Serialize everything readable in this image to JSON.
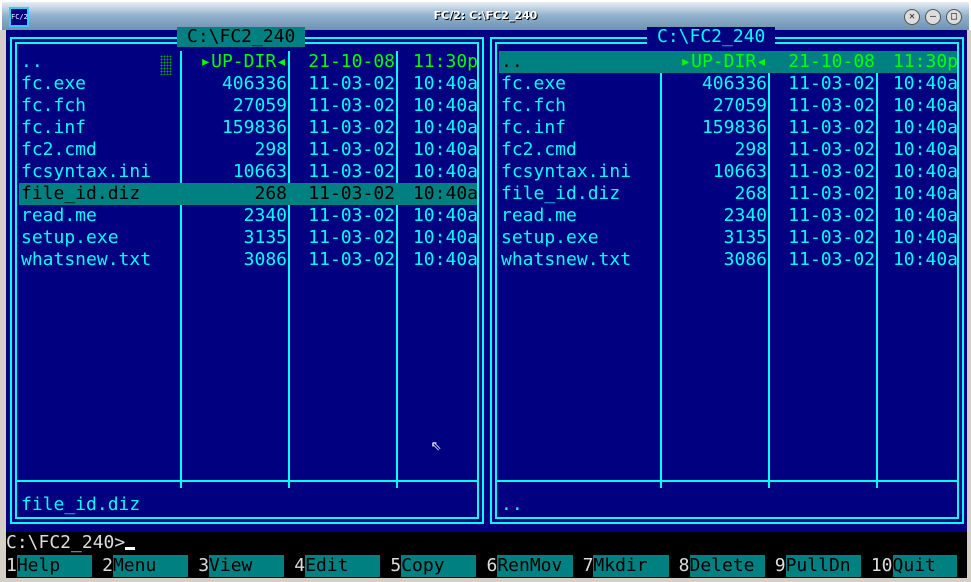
{
  "window": {
    "title": "FC/2: C:\\FC2_240",
    "icon": "FC/2"
  },
  "panels": [
    {
      "path": "C:\\FC2_240",
      "active": true,
      "info": "file_id.diz",
      "selected": 5,
      "files": [
        {
          "name": "..",
          "size": "▸UP-DIR◂",
          "date": "21-10-08",
          "time": "11:30p"
        },
        {
          "name": "fc.exe",
          "size": "406336",
          "date": "11-03-02",
          "time": "10:40a"
        },
        {
          "name": "fc.fch",
          "size": "27059",
          "date": "11-03-02",
          "time": "10:40a"
        },
        {
          "name": "fc.inf",
          "size": "159836",
          "date": "11-03-02",
          "time": "10:40a"
        },
        {
          "name": "fc2.cmd",
          "size": "298",
          "date": "11-03-02",
          "time": "10:40a"
        },
        {
          "name": "fcsyntax.ini",
          "size": "10663",
          "date": "11-03-02",
          "time": "10:40a"
        },
        {
          "name": "file_id.diz",
          "size": "268",
          "date": "11-03-02",
          "time": "10:40a"
        },
        {
          "name": "read.me",
          "size": "2340",
          "date": "11-03-02",
          "time": "10:40a"
        },
        {
          "name": "setup.exe",
          "size": "3135",
          "date": "11-03-02",
          "time": "10:40a"
        },
        {
          "name": "whatsnew.txt",
          "size": "3086",
          "date": "11-03-02",
          "time": "10:40a"
        }
      ]
    },
    {
      "path": "C:\\FC2_240",
      "active": false,
      "info": "..",
      "selected": -1,
      "files": [
        {
          "name": "..",
          "size": "▸UP-DIR◂",
          "date": "21-10-08",
          "time": "11:30p"
        },
        {
          "name": "fc.exe",
          "size": "406336",
          "date": "11-03-02",
          "time": "10:40a"
        },
        {
          "name": "fc.fch",
          "size": "27059",
          "date": "11-03-02",
          "time": "10:40a"
        },
        {
          "name": "fc.inf",
          "size": "159836",
          "date": "11-03-02",
          "time": "10:40a"
        },
        {
          "name": "fc2.cmd",
          "size": "298",
          "date": "11-03-02",
          "time": "10:40a"
        },
        {
          "name": "fcsyntax.ini",
          "size": "10663",
          "date": "11-03-02",
          "time": "10:40a"
        },
        {
          "name": "file_id.diz",
          "size": "268",
          "date": "11-03-02",
          "time": "10:40a"
        },
        {
          "name": "read.me",
          "size": "2340",
          "date": "11-03-02",
          "time": "10:40a"
        },
        {
          "name": "setup.exe",
          "size": "3135",
          "date": "11-03-02",
          "time": "10:40a"
        },
        {
          "name": "whatsnew.txt",
          "size": "3086",
          "date": "11-03-02",
          "time": "10:40a"
        }
      ]
    }
  ],
  "command_prompt": "C:\\FC2_240>",
  "keybar": [
    {
      "num": "1",
      "label": "Help"
    },
    {
      "num": "2",
      "label": "Menu"
    },
    {
      "num": "3",
      "label": "View"
    },
    {
      "num": "4",
      "label": "Edit"
    },
    {
      "num": "5",
      "label": "Copy"
    },
    {
      "num": "6",
      "label": "RenMov"
    },
    {
      "num": "7",
      "label": "Mkdir"
    },
    {
      "num": "8",
      "label": "Delete"
    },
    {
      "num": "9",
      "label": "PullDn"
    },
    {
      "num": "10",
      "label": "Quit"
    }
  ]
}
